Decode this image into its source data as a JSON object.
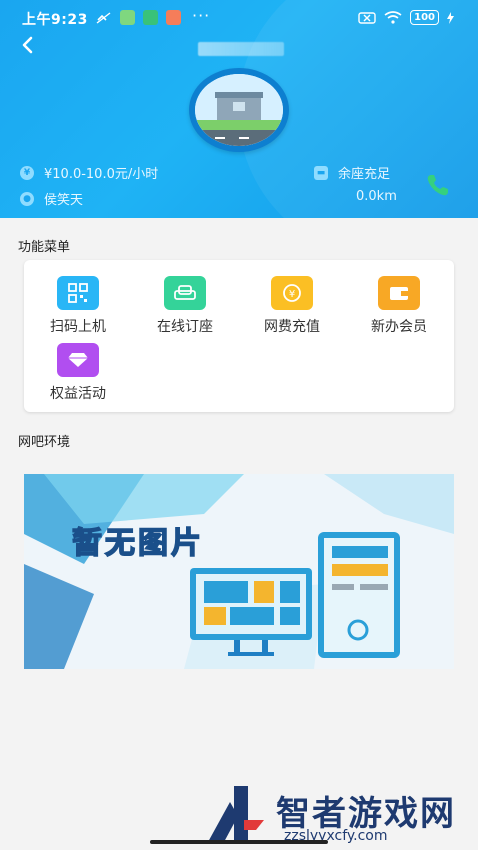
{
  "status_bar": {
    "time": "上午9:23",
    "dots": "···",
    "battery": "100"
  },
  "header": {
    "back_icon": "back-arrow-icon"
  },
  "shop": {
    "price": "¥10.0-10.0元/小时",
    "location": "侯笑天",
    "seats": "余座充足",
    "distance": "0.0km"
  },
  "menu": {
    "title": "功能菜单",
    "items": [
      {
        "label": "扫码上机",
        "icon": "qr-code-icon",
        "color": "#29b6f6"
      },
      {
        "label": "在线订座",
        "icon": "sofa-icon",
        "color": "#34d399"
      },
      {
        "label": "网费充值",
        "icon": "coin-icon",
        "color": "#fbbf24"
      },
      {
        "label": "新办会员",
        "icon": "wallet-icon",
        "color": "#f8a825"
      },
      {
        "label": "权益活动",
        "icon": "diamond-icon",
        "color": "#b14ef0"
      }
    ]
  },
  "environment": {
    "title": "网吧环境",
    "placeholder_text": "暂无图片"
  },
  "watermark": {
    "brand": "智者游戏网",
    "url": "zzslyyxcfy.com"
  }
}
